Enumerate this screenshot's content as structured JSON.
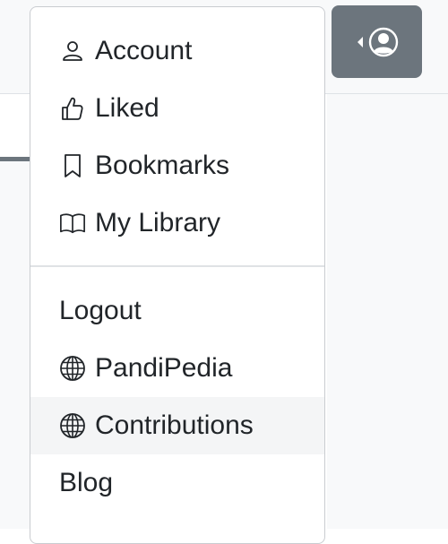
{
  "user_menu": {
    "items": [
      {
        "label": "Account",
        "icon": "person-icon"
      },
      {
        "label": "Liked",
        "icon": "thumbs-up-icon"
      },
      {
        "label": "Bookmarks",
        "icon": "bookmark-icon"
      },
      {
        "label": "My Library",
        "icon": "book-icon"
      }
    ],
    "secondary_items": [
      {
        "label": "Logout",
        "icon": ""
      },
      {
        "label": "PandiPedia",
        "icon": "globe-icon"
      },
      {
        "label": "Contributions",
        "icon": "globe-icon"
      },
      {
        "label": "Blog",
        "icon": ""
      }
    ]
  },
  "colors": {
    "button_bg": "#6c757d",
    "text": "#212529",
    "hover_bg": "#f4f5f6",
    "border": "#c9ccd0"
  }
}
